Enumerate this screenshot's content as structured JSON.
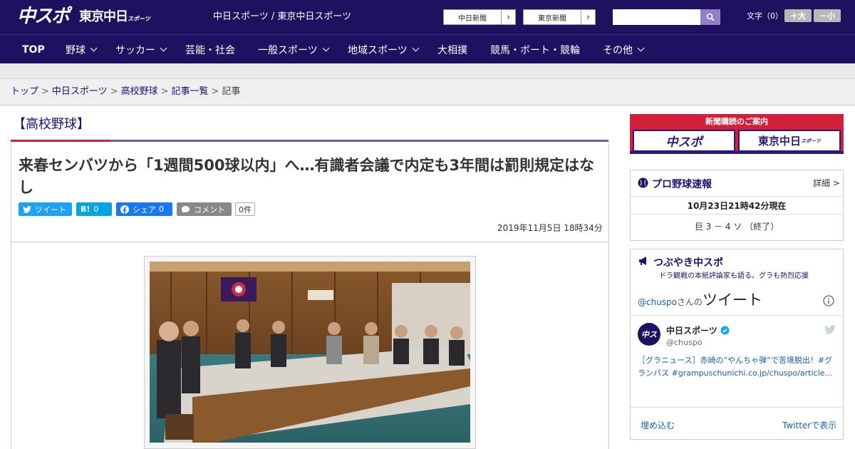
{
  "header": {
    "logo_main": "中スポ",
    "logo_tokyo": "東京中日",
    "logo_tokyo_sub": "スポーツ",
    "site_links": "中日スポーツ / 東京中日スポーツ",
    "buttons": [
      {
        "label": "中日新聞"
      },
      {
        "label": "東京新聞"
      }
    ],
    "search": {
      "placeholder": "",
      "value": ""
    },
    "font_size": {
      "label": "文字（0）",
      "larger": "＋大",
      "smaller": "－小"
    }
  },
  "nav": {
    "items": [
      {
        "label": "TOP",
        "dropdown": false
      },
      {
        "label": "野球",
        "dropdown": true
      },
      {
        "label": "サッカー",
        "dropdown": true
      },
      {
        "label": "芸能・社会",
        "dropdown": false
      },
      {
        "label": "一般スポーツ",
        "dropdown": true
      },
      {
        "label": "地域スポーツ",
        "dropdown": true
      },
      {
        "label": "大相撲",
        "dropdown": false
      },
      {
        "label": "競馬・ボート・競輪",
        "dropdown": false
      },
      {
        "label": "その他",
        "dropdown": true
      }
    ]
  },
  "breadcrumb": {
    "items": [
      "トップ",
      "中日スポーツ",
      "高校野球",
      "記事一覧",
      "記事"
    ],
    "separator": ">"
  },
  "article": {
    "section": "【高校野球】",
    "headline": "来春センバツから「1週間500球以内」へ…有識者会議で内定も3年間は罰則規定はなし",
    "share": {
      "tweet": "ツイート",
      "hatena_icon": "B!",
      "hatena_count": "0",
      "facebook": "シェア",
      "facebook_count": "0",
      "comment": "コメント",
      "comment_count": "0件"
    },
    "date": "2019年11月5日 18時34分"
  },
  "sidebar": {
    "subscribe": {
      "title": "新聞購読のご案内",
      "left": "中スポ",
      "right": "東京中日",
      "right_sub": "スポーツ"
    },
    "baseball": {
      "title": "プロ野球速報",
      "detail": "詳細 >",
      "time": "10月23日21時42分現在",
      "score": "巨 3 － 4 ソ （終了）"
    },
    "tweets": {
      "title": "つぶやき中スポ",
      "subtitle": "ドラ観戦の本紙評論家も語る。グラも熱烈応援",
      "handle": "@chuspo",
      "handle_suffix": "さんの",
      "heading": "ツイート",
      "account_name": "中日スポーツ",
      "account_handle": "@chuspo",
      "tweet_text": "［グラニュース］赤崎の“やんちゃ弾”で苦境脱出！#グランパス #grampuschunichi.co.jp/chuspo/article…",
      "embed": "埋め込む",
      "view_on_twitter": "Twitterで表示"
    }
  },
  "colors": {
    "header_bg": "#1f1060",
    "accent_red": "#d41f3a",
    "link": "#1f1070",
    "twitter": "#1da1f2",
    "hatena": "#00a4de",
    "facebook": "#1877f2",
    "comment": "#888888"
  },
  "icons": [
    "search-icon",
    "chevron-right-icon",
    "chevron-down-icon",
    "twitter-icon",
    "facebook-icon",
    "comment-icon",
    "baseball-icon",
    "megaphone-icon",
    "info-icon",
    "verified-icon"
  ]
}
